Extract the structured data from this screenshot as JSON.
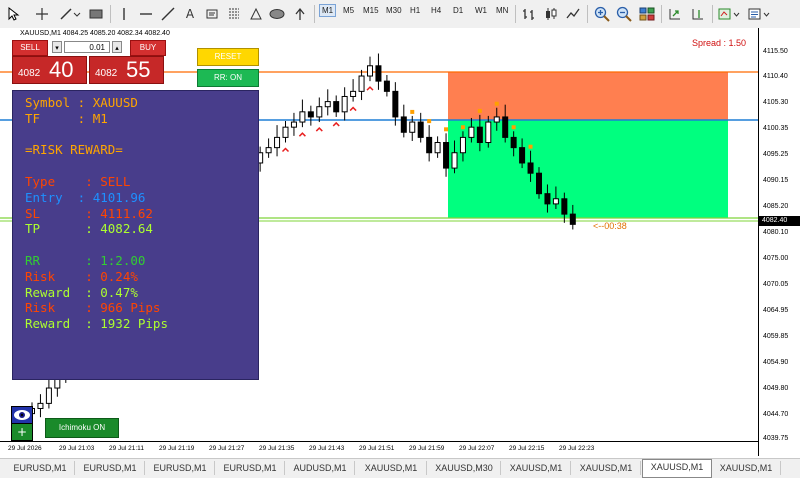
{
  "toolbar": {
    "tools": [
      "cursor-icon",
      "crosshair-icon",
      "line-tools-icon",
      "rectangle-icon",
      "horizontal-line-icon",
      "vertical-line-icon",
      "trendline-icon",
      "text-icon",
      "label-icon",
      "fibonacci-icon",
      "shapes-icon",
      "ellipse-icon",
      "arrow-icon",
      "arrow-down-icon"
    ],
    "timeframes": [
      "M1",
      "M5",
      "M15",
      "M30",
      "H1",
      "H4",
      "D1",
      "W1",
      "MN"
    ],
    "active_timeframe": "M1"
  },
  "chart": {
    "symbol_header": "XAUUSD,M1  4084.25 4085.20 4082.34 4082.40",
    "spread": "Spread : 1.50",
    "countdown": "<--00:38",
    "current_price": "4082.40",
    "price_ticks": [
      "4115.50",
      "4110.40",
      "4105.30",
      "4100.35",
      "4095.25",
      "4090.15",
      "4085.20",
      "4080.10",
      "4075.00",
      "4070.05",
      "4064.95",
      "4059.85",
      "4054.90",
      "4049.80",
      "4044.70",
      "4039.75"
    ],
    "time_ticks": [
      "29 Jul 2026",
      "29 Jul 21:03",
      "29 Jul 21:11",
      "29 Jul 21:19",
      "29 Jul 21:27",
      "29 Jul 21:35",
      "29 Jul 21:43",
      "29 Jul 21:51",
      "29 Jul 21:59",
      "29 Jul 22:07",
      "29 Jul 22:15",
      "29 Jul 22:23"
    ],
    "colors": {
      "sl_zone": "#ff7f50",
      "tp_zone": "#00ff7f",
      "sl_line": "#ff6a00",
      "entry_line": "#1e7fd6",
      "tp_line": "#7fd43a",
      "bull_arrow": "#e82020",
      "trail": "#ffa000"
    }
  },
  "trade_panel": {
    "sell_label": "SELL",
    "buy_label": "BUY",
    "lot": "0.01",
    "sell_small": "4082",
    "sell_big": "40",
    "buy_small": "4082",
    "buy_big": "55"
  },
  "buttons": {
    "reset": "RESET",
    "rr": "RR: ON",
    "ichimoku": "Ichimoku ON"
  },
  "info_panel": {
    "lines": [
      {
        "text": "Symbol : XAUUSD",
        "color": "#ffa500"
      },
      {
        "text": "TF     : M1",
        "color": "#ffa500"
      },
      {
        "text": "",
        "color": "#ffa500"
      },
      {
        "text": "=RISK REWARD=",
        "color": "#ffa500"
      },
      {
        "text": "",
        "color": "#ffa500"
      },
      {
        "text": "Type    : SELL",
        "color": "#ff4500"
      },
      {
        "text": "Entry  : 4101.96",
        "color": "#1e90ff"
      },
      {
        "text": "SL      : 4111.62",
        "color": "#ff4500"
      },
      {
        "text": "TP      : 4082.64",
        "color": "#adff2f"
      },
      {
        "text": "",
        "color": "#ffa500"
      },
      {
        "text": "RR      : 1:2.00",
        "color": "#32cd32"
      },
      {
        "text": "Risk    : 0.24%",
        "color": "#ff4500"
      },
      {
        "text": "Reward  : 0.47%",
        "color": "#adff2f"
      },
      {
        "text": "Risk    : 966 Pips",
        "color": "#ff4500"
      },
      {
        "text": "Reward  : 1932 Pips",
        "color": "#adff2f"
      }
    ]
  },
  "tabs": [
    "EURUSD,M1",
    "EURUSD,M1",
    "EURUSD,M1",
    "EURUSD,M1",
    "AUDUSD,M1",
    "XAUUSD,M1",
    "XAUUSD,M30",
    "XAUUSD,M1",
    "XAUUSD,M1",
    "XAUUSD,M1",
    "XAUUSD,M1"
  ],
  "active_tab_index": 9
}
